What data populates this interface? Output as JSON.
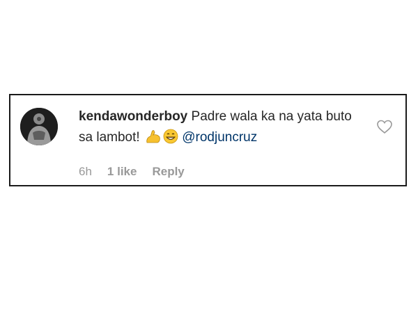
{
  "comment": {
    "username": "kendawonderboy",
    "text_before_emoji": "Padre wala ka na yata buto sa lambot!",
    "emojis": [
      "flexed-biceps-icon",
      "grinning-face-icon"
    ],
    "mention": "@rodjuncruz",
    "timestamp": "6h",
    "likes": "1 like",
    "reply_label": "Reply"
  },
  "colors": {
    "text": "#262626",
    "meta": "#999999",
    "mention": "#003569",
    "border": "#1a1a1a"
  }
}
